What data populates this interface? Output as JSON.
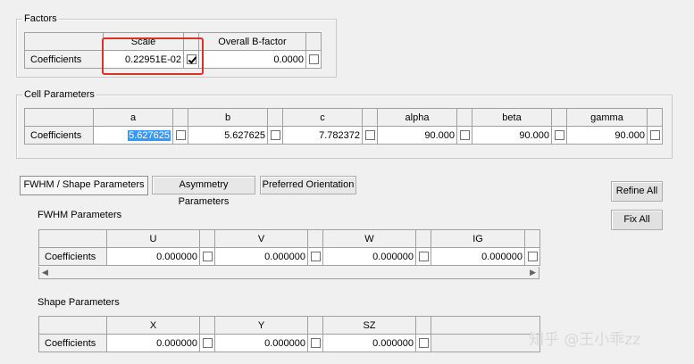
{
  "factors": {
    "title": "Factors",
    "headers": [
      "Scale",
      "Overall B-factor"
    ],
    "row_label": "Coefficients",
    "scale_value": "0.22951E-02",
    "scale_refined": true,
    "bfactor_value": "0.0000",
    "bfactor_refined": false
  },
  "cell": {
    "title": "Cell Parameters",
    "row_label": "Coefficients",
    "columns": [
      {
        "name": "a",
        "value": "5.627625"
      },
      {
        "name": "b",
        "value": "5.627625"
      },
      {
        "name": "c",
        "value": "7.782372"
      },
      {
        "name": "alpha",
        "value": "90.000"
      },
      {
        "name": "beta",
        "value": "90.000"
      },
      {
        "name": "gamma",
        "value": "90.000"
      }
    ]
  },
  "tabs": [
    {
      "label": "FWHM / Shape Parameters",
      "active": true
    },
    {
      "label": "Asymmetry Parameters",
      "active": false
    },
    {
      "label": "Preferred Orientation",
      "active": false
    }
  ],
  "buttons": {
    "refine_all": "Refine All",
    "fix_all": "Fix All"
  },
  "fwhm": {
    "title": "FWHM Parameters",
    "row_label": "Coefficients",
    "columns": [
      {
        "name": "U",
        "value": "0.000000"
      },
      {
        "name": "V",
        "value": "0.000000"
      },
      {
        "name": "W",
        "value": "0.000000"
      },
      {
        "name": "IG",
        "value": "0.000000"
      }
    ]
  },
  "shape": {
    "title": "Shape Parameters",
    "row_label": "Coefficients",
    "columns": [
      {
        "name": "X",
        "value": "0.000000"
      },
      {
        "name": "Y",
        "value": "0.000000"
      },
      {
        "name": "SZ",
        "value": "0.000000"
      }
    ]
  },
  "watermark": "知乎 @王小乖zz",
  "colors": {
    "selection": "#3399ff",
    "highlight_box": "#e0302a",
    "window_bg": "#f0f0f0"
  }
}
